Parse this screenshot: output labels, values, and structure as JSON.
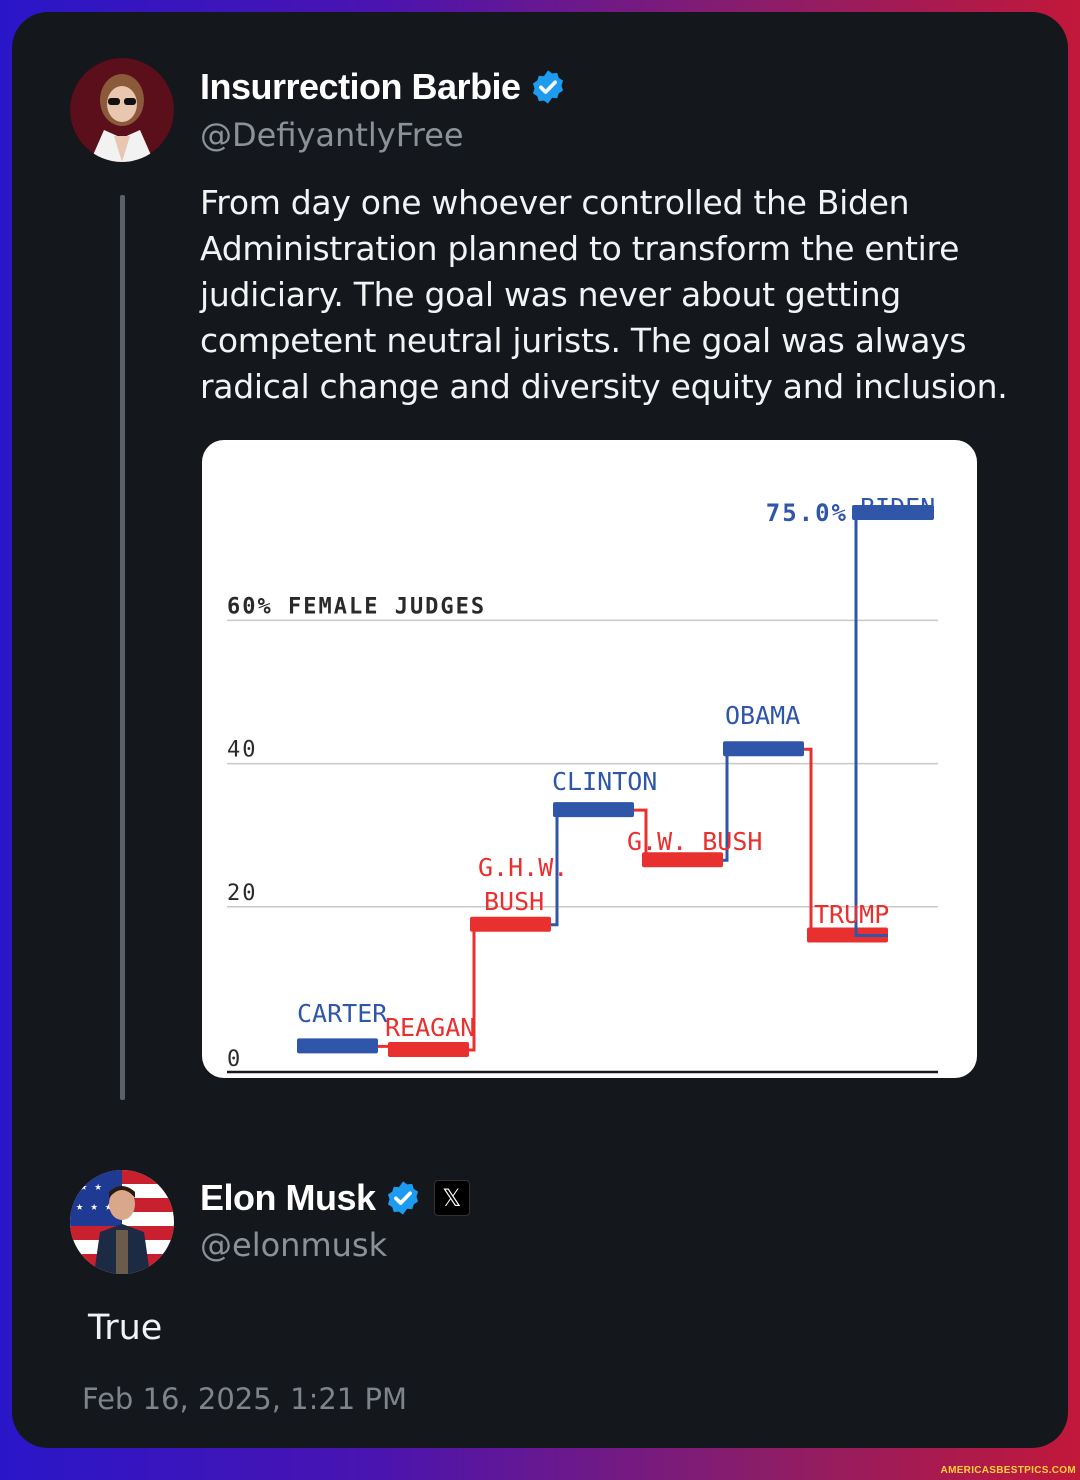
{
  "tweet1": {
    "display_name": "Insurrection Barbie",
    "handle": "@DefiyantlyFree",
    "verified_icon": "verified-badge-icon",
    "text": "From day one whoever controlled the Biden Administration planned to transform the entire judiciary. The goal was never about getting competent neutral jurists. The goal was always radical change and diversity equity and inclusion."
  },
  "tweet2": {
    "display_name": "Elon Musk",
    "handle": "@elonmusk",
    "verified_icon": "verified-badge-icon",
    "affiliation_badge": "𝕏",
    "text": "True",
    "timestamp": "Feb 16, 2025, 1:21 PM"
  },
  "colors": {
    "democrat": "#2f56a8",
    "republican": "#e8302f",
    "verified": "#1d9bf0"
  },
  "watermark": "AMERICASBESTPICS.COM",
  "chart_data": {
    "type": "line",
    "title": "60% FEMALE JUDGES",
    "ytick_labels": [
      "0",
      "20",
      "40",
      "60% FEMALE JUDGES"
    ],
    "y_ticks": [
      0,
      20,
      40,
      60
    ],
    "ylim": [
      0,
      80
    ],
    "value_label": "75.0%",
    "series": [
      {
        "name": "CARTER",
        "party": "D",
        "value": 0.5
      },
      {
        "name": "REAGAN",
        "party": "R",
        "value": 0
      },
      {
        "name": "G.H.W. BUSH",
        "party": "R",
        "value": 17.5
      },
      {
        "name": "CLINTON",
        "party": "D",
        "value": 33.5
      },
      {
        "name": "G.W. BUSH",
        "party": "R",
        "value": 26.5
      },
      {
        "name": "OBAMA",
        "party": "D",
        "value": 42
      },
      {
        "name": "TRUMP",
        "party": "R",
        "value": 16
      },
      {
        "name": "BIDEN",
        "party": "D",
        "value": 75.0
      }
    ]
  }
}
